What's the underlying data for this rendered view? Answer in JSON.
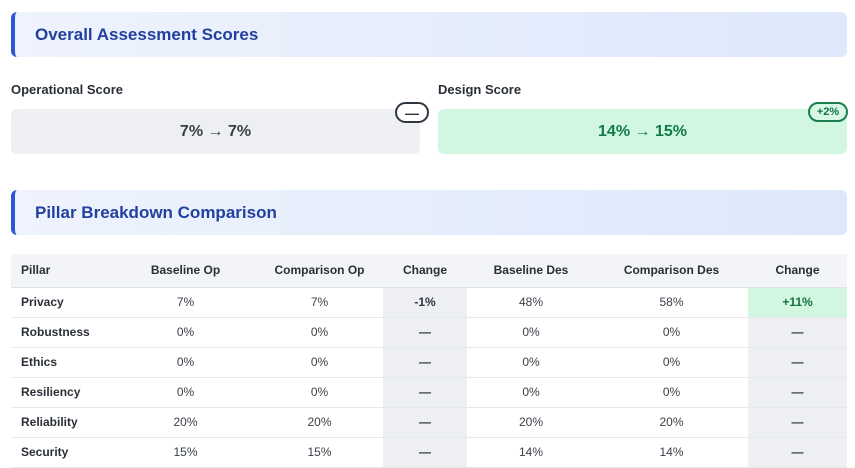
{
  "sections": {
    "overall_title": "Overall Assessment Scores",
    "pillar_title": "Pillar Breakdown Comparison"
  },
  "operational": {
    "label": "Operational Score",
    "value": "7% → 7%",
    "badge": "—"
  },
  "design": {
    "label": "Design Score",
    "value": "14% → 15%",
    "badge": "+2%"
  },
  "colors": {
    "accent": "#2d55d6",
    "positive_bg": "#d1f7e1",
    "neutral_bg": "#eeeff2"
  },
  "table": {
    "headers": [
      "Pillar",
      "Baseline Op",
      "Comparison Op",
      "Change",
      "Baseline Des",
      "Comparison Des",
      "Change"
    ],
    "rows": [
      {
        "pillar": "Privacy",
        "base_op": "7%",
        "comp_op": "7%",
        "chg_op": "-1%",
        "base_des": "48%",
        "comp_des": "58%",
        "chg_des": "+11%"
      },
      {
        "pillar": "Robustness",
        "base_op": "0%",
        "comp_op": "0%",
        "chg_op": "—",
        "base_des": "0%",
        "comp_des": "0%",
        "chg_des": "—"
      },
      {
        "pillar": "Ethics",
        "base_op": "0%",
        "comp_op": "0%",
        "chg_op": "—",
        "base_des": "0%",
        "comp_des": "0%",
        "chg_des": "—"
      },
      {
        "pillar": "Resiliency",
        "base_op": "0%",
        "comp_op": "0%",
        "chg_op": "—",
        "base_des": "0%",
        "comp_des": "0%",
        "chg_des": "—"
      },
      {
        "pillar": "Reliability",
        "base_op": "20%",
        "comp_op": "20%",
        "chg_op": "—",
        "base_des": "20%",
        "comp_des": "20%",
        "chg_des": "—"
      },
      {
        "pillar": "Security",
        "base_op": "15%",
        "comp_op": "15%",
        "chg_op": "—",
        "base_des": "14%",
        "comp_des": "14%",
        "chg_des": "—"
      }
    ]
  }
}
